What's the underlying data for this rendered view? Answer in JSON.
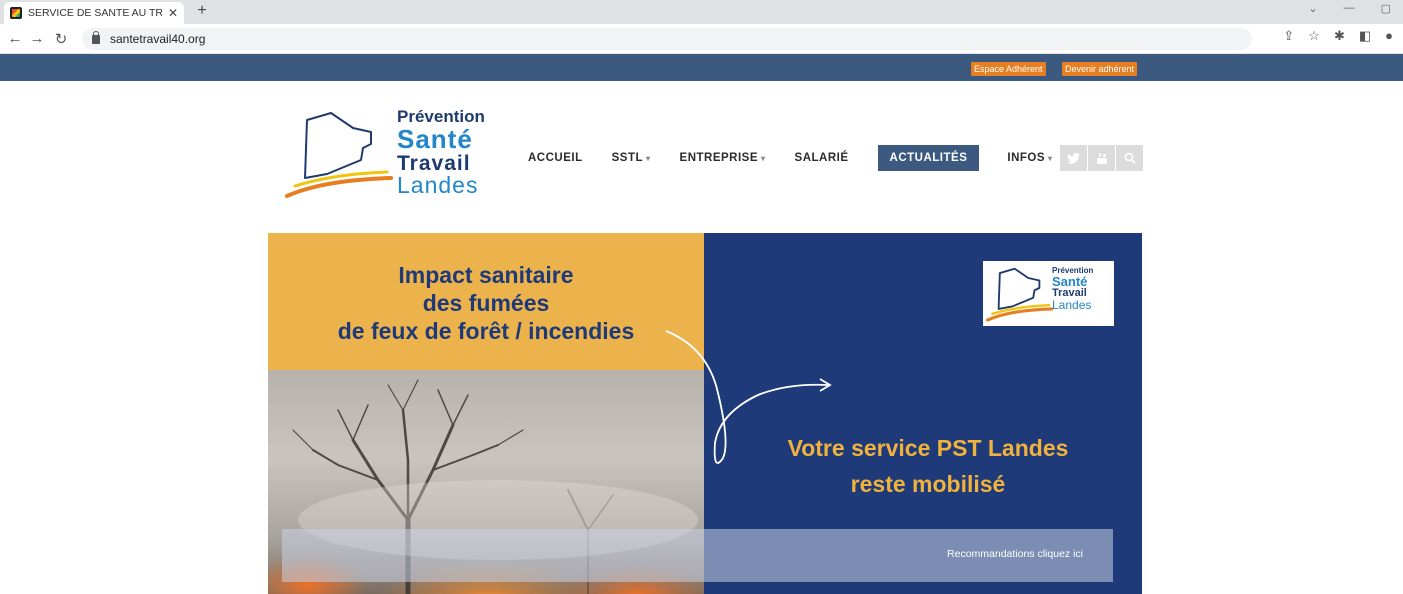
{
  "browser": {
    "tab_title": "SERVICE DE SANTE AU TRAVAIL D",
    "tab_close": "✕",
    "new_tab": "+",
    "url": "santetravail40.org",
    "win_controls": [
      "⌄",
      "—",
      "▢"
    ]
  },
  "topbar": {
    "espace_adherent": "Espace Adhérent",
    "devenir_adherent": "Devenir adhérent"
  },
  "logo": {
    "line1": "Prévention",
    "line2": "Santé",
    "line3": "Travail",
    "line4": "Landes"
  },
  "nav": {
    "items": [
      {
        "label": "ACCUEIL",
        "has_caret": false
      },
      {
        "label": "SSTL",
        "has_caret": true
      },
      {
        "label": "ENTREPRISE",
        "has_caret": true
      },
      {
        "label": "SALARIÉ",
        "has_caret": false
      },
      {
        "label": "ACTUALITÉS",
        "has_caret": false,
        "active": true
      },
      {
        "label": "INFOS",
        "has_caret": true
      }
    ],
    "caret": "▾"
  },
  "social": {
    "icons": [
      "twitter-icon",
      "youtube-icon",
      "search-icon"
    ],
    "glyphs": [
      "🐦",
      "▶",
      "⌕"
    ]
  },
  "hero": {
    "title_line1": "Impact sanitaire",
    "title_line2": "des fumées",
    "title_line3": "de feux de forêt / incendies",
    "sub_line1": "Votre service PST Landes",
    "sub_line2": "reste mobilisé",
    "link": "Recommandations cliquez ici"
  },
  "colors": {
    "header_blue": "#3c5a80",
    "orange": "#e67e22",
    "hero_yellow": "#ecb24c",
    "hero_blue": "#1e3a78"
  }
}
